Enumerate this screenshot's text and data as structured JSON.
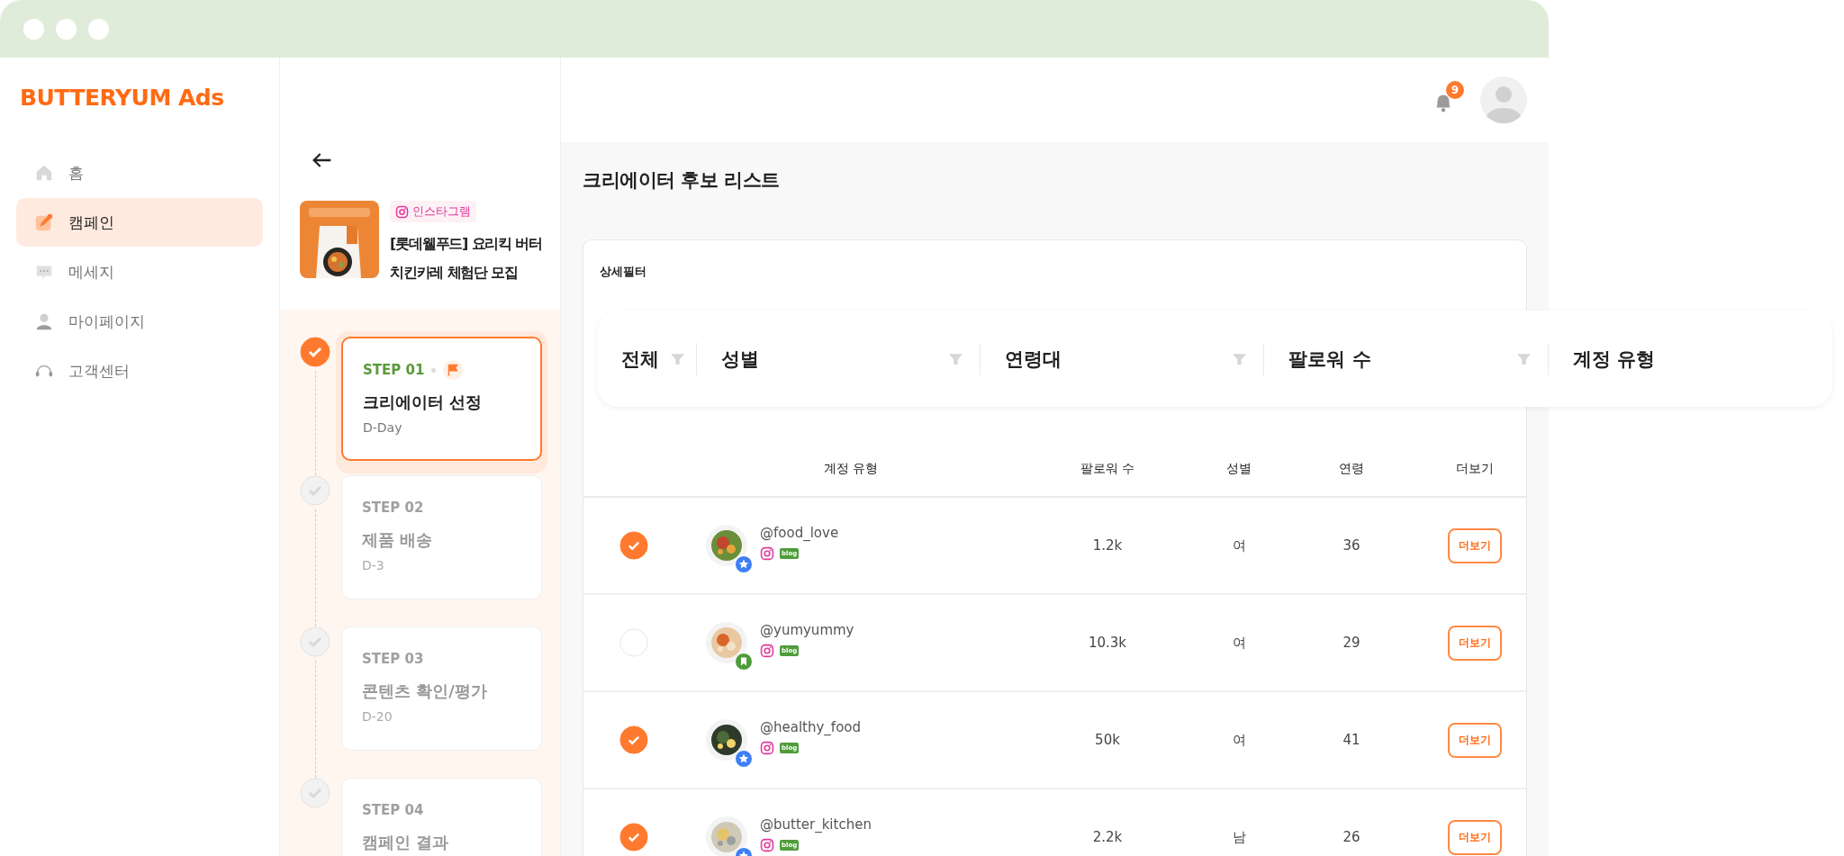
{
  "brand": "BUTTERYUM Ads",
  "nav": [
    {
      "label": "홈",
      "selected": false
    },
    {
      "label": "캠페인",
      "selected": true
    },
    {
      "label": "메세지",
      "selected": false
    },
    {
      "label": "마이페이지",
      "selected": false
    },
    {
      "label": "고객센터",
      "selected": false
    }
  ],
  "campaign": {
    "platform": "인스타그램",
    "title": "[롯데웰푸드] 요리킥 버터치킨카레 체험단 모집"
  },
  "steps": [
    {
      "step": "STEP 01",
      "name": "크리에이터 선정",
      "due": "D-Day",
      "selected": true
    },
    {
      "step": "STEP 02",
      "name": "제품 배송",
      "due": "D-3",
      "selected": false
    },
    {
      "step": "STEP 03",
      "name": "콘텐츠 확인/평가",
      "due": "D-20",
      "selected": false
    },
    {
      "step": "STEP 04",
      "name": "캠페인 결과",
      "selected": false
    }
  ],
  "notifications": "9",
  "page_title": "크리에이터 후보 리스트",
  "filter_label": "상세필터",
  "filters": [
    {
      "label": "전체"
    },
    {
      "label": "성별"
    },
    {
      "label": "연령대"
    },
    {
      "label": "팔로워 수"
    },
    {
      "label": "계정 유형"
    }
  ],
  "table": {
    "columns": [
      "계정 유형",
      "팔로워 수",
      "성별",
      "연령",
      "더보기"
    ],
    "rows": [
      {
        "checked": true,
        "handle": "@food_love",
        "kind": "star",
        "blog": "blog",
        "followers": "1.2k",
        "gender": "여",
        "age": "36",
        "action": "더보기"
      },
      {
        "checked": false,
        "handle": "@yumyummy",
        "kind": "bookmark",
        "blog": "blog",
        "followers": "10.3k",
        "gender": "여",
        "age": "29",
        "action": "더보기"
      },
      {
        "checked": true,
        "handle": "@healthy_food",
        "kind": "star",
        "blog": "blog",
        "followers": "50k",
        "gender": "여",
        "age": "41",
        "action": "더보기"
      },
      {
        "checked": true,
        "handle": "@butter_kitchen",
        "kind": "star",
        "blog": "blog",
        "followers": "2.2k",
        "gender": "남",
        "age": "26",
        "action": "더보기"
      }
    ]
  }
}
